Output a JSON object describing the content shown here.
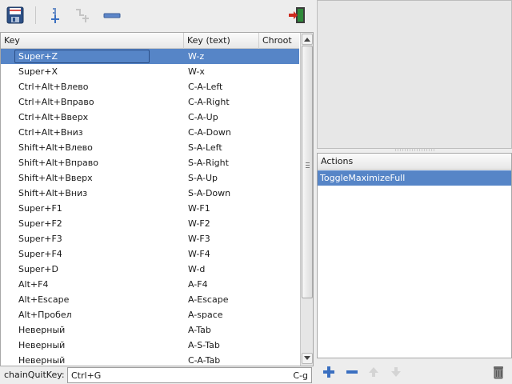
{
  "toolbar": {
    "save_icon": "floppy-disk-icon",
    "add_key_icon": "add-key-icon",
    "add_chain_icon": "add-chain-icon",
    "remove_icon": "minus-icon",
    "quit_icon": "exit-door-icon"
  },
  "table": {
    "columns": [
      "Key",
      "Key (text)",
      "Chroot"
    ],
    "rows": [
      {
        "key": "Super+Z",
        "text": "W-z"
      },
      {
        "key": "Super+X",
        "text": "W-x"
      },
      {
        "key": "Ctrl+Alt+Влево",
        "text": "C-A-Left"
      },
      {
        "key": "Ctrl+Alt+Вправо",
        "text": "C-A-Right"
      },
      {
        "key": "Ctrl+Alt+Вверх",
        "text": "C-A-Up"
      },
      {
        "key": "Ctrl+Alt+Вниз",
        "text": "C-A-Down"
      },
      {
        "key": "Shift+Alt+Влево",
        "text": "S-A-Left"
      },
      {
        "key": "Shift+Alt+Вправо",
        "text": "S-A-Right"
      },
      {
        "key": "Shift+Alt+Вверх",
        "text": "S-A-Up"
      },
      {
        "key": "Shift+Alt+Вниз",
        "text": "S-A-Down"
      },
      {
        "key": "Super+F1",
        "text": "W-F1"
      },
      {
        "key": "Super+F2",
        "text": "W-F2"
      },
      {
        "key": "Super+F3",
        "text": "W-F3"
      },
      {
        "key": "Super+F4",
        "text": "W-F4"
      },
      {
        "key": "Super+D",
        "text": "W-d"
      },
      {
        "key": "Alt+F4",
        "text": "A-F4"
      },
      {
        "key": "Alt+Escape",
        "text": "A-Escape"
      },
      {
        "key": "Alt+Пробел",
        "text": "A-space"
      },
      {
        "key": "Неверный",
        "text": "A-Tab"
      },
      {
        "key": "Неверный",
        "text": "A-S-Tab"
      },
      {
        "key": "Неверный",
        "text": "C-A-Tab"
      }
    ],
    "selected_index": 0
  },
  "chain": {
    "label": "chainQuitKey:",
    "value": "Ctrl+G",
    "text": "C-g"
  },
  "actions": {
    "header": "Actions",
    "items": [
      "ToggleMaximizeFull"
    ],
    "selected_index": 0
  },
  "colors": {
    "selection": "#5685c7",
    "accent_blue": "#3a6fc0",
    "exit_red": "#c0392b"
  }
}
